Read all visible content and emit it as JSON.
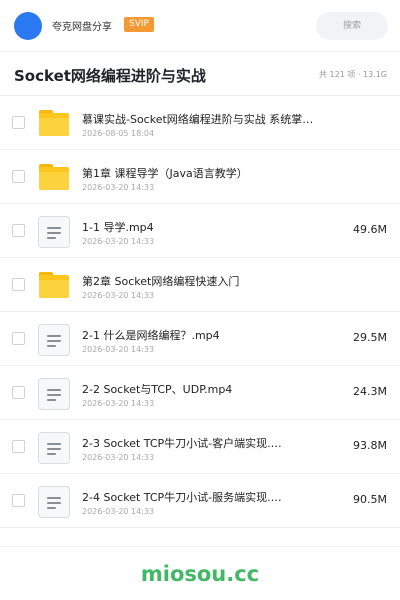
{
  "header": {
    "brand": "夸克网盘分享",
    "badge": "SVIP",
    "search_placeholder": "搜索"
  },
  "page": {
    "title": "Socket网络编程进阶与实战",
    "summary": "共 121 项 · 13.1G"
  },
  "files": [
    {
      "type": "folder",
      "name": "慕课实战-Socket网络编程进阶与实战 系统掌握…",
      "date": "2026-08-05 18:04",
      "size": ""
    },
    {
      "type": "folder",
      "name": "第1章 课程导学（Java语言教学）",
      "date": "2026-03-20 14:33",
      "size": ""
    },
    {
      "type": "file",
      "name": "1-1 导学.mp4",
      "date": "2026-03-20 14:33",
      "size": "49.6M"
    },
    {
      "type": "folder",
      "name": "第2章 Socket网络编程快速入门",
      "date": "2026-03-20 14:33",
      "size": ""
    },
    {
      "type": "file",
      "name": "2-1 什么是网络编程？.mp4",
      "date": "2026-03-20 14:33",
      "size": "29.5M"
    },
    {
      "type": "file",
      "name": "2-2 Socket与TCP、UDP.mp4",
      "date": "2026-03-20 14:33",
      "size": "24.3M"
    },
    {
      "type": "file",
      "name": "2-3 Socket TCP牛刀小试-客户端实现.…",
      "date": "2026-03-20 14:33",
      "size": "93.8M"
    },
    {
      "type": "file",
      "name": "2-4 Socket TCP牛刀小试-服务端实现.…",
      "date": "2026-03-20 14:33",
      "size": "90.5M"
    }
  ],
  "watermark": "miosou.cc",
  "colors": {
    "avatar": "#2a79f0",
    "badge": "#f39a34",
    "folder": "#fcc61c",
    "watermark": "#41b865"
  }
}
